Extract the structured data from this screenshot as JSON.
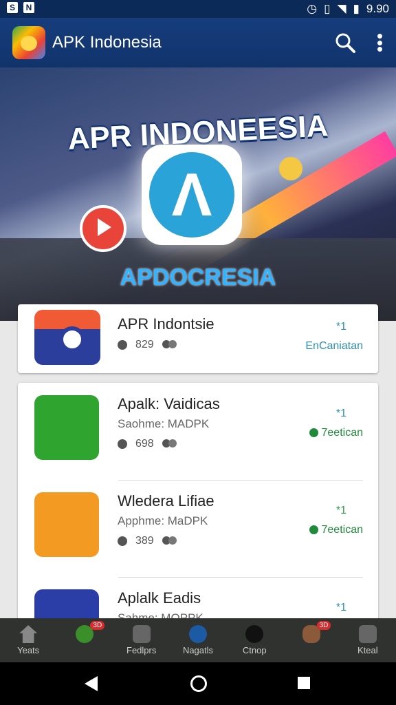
{
  "status_bar": {
    "time": "9.90",
    "left_icons": [
      "S",
      "N"
    ]
  },
  "app_bar": {
    "title": "APK Indonesia"
  },
  "hero": {
    "title": "APR INDONEESIA",
    "subtitle": "APDOCRESIA"
  },
  "featured": {
    "name": "APR Indontsie",
    "downloads": "829",
    "rating": "*1",
    "status": "EnCaniatan"
  },
  "apps": [
    {
      "name": "Apalk: Vaidicas",
      "sub": "Saohme: MADPK",
      "downloads": "698",
      "rating": "*1",
      "status": "7eetican"
    },
    {
      "name": "Wledera Lifiae",
      "sub": "Apphme: MaDPK",
      "downloads": "389",
      "rating": "*1",
      "status": "7eetican"
    },
    {
      "name": "Aplalk Eadis",
      "sub": "Sahme: MOPPK",
      "downloads": "",
      "rating": "*1",
      "status": ""
    }
  ],
  "bottom_nav": [
    {
      "label": "Yeats"
    },
    {
      "label": "",
      "badge": "3D"
    },
    {
      "label": "Fedlprs"
    },
    {
      "label": "Nagatls"
    },
    {
      "label": "Ctnop"
    },
    {
      "label": "",
      "badge": "3D"
    },
    {
      "label": "Kteal"
    }
  ]
}
